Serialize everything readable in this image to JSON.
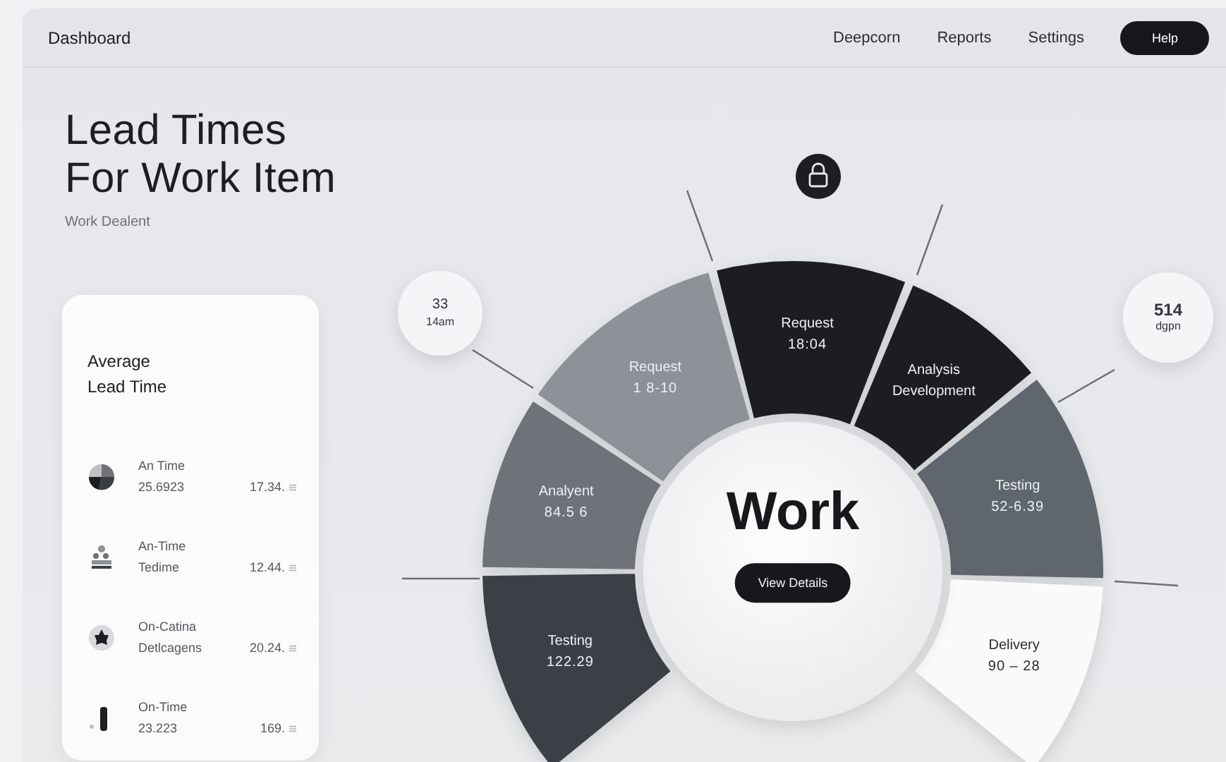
{
  "nav": {
    "title": "Dashboard",
    "links": [
      "Deepcorn",
      "Reports",
      "Settings"
    ],
    "help": "Help"
  },
  "heading": {
    "title": "Lead Times\nFor Work Item",
    "subtitle": "Work Dealent"
  },
  "card": {
    "title": "Average\nLead Time",
    "items": [
      {
        "kind": "pie",
        "name": "An Time",
        "detail": "25.6923",
        "value": "17.34."
      },
      {
        "kind": "people",
        "name": "An-Time",
        "detail": "Tedime",
        "value": "12.44."
      },
      {
        "kind": "badge",
        "name": "On-Catina",
        "detail": "Detlcagens",
        "value": "20.24."
      },
      {
        "kind": "bar",
        "name": "On-Time",
        "detail": "23.223",
        "value": "169."
      }
    ]
  },
  "wheel": {
    "center": "Work",
    "button": "View Details",
    "segments": [
      {
        "name": "Request",
        "value": "18:04",
        "color": "#1c1e22"
      },
      {
        "name": "Request",
        "value": "1 8-10",
        "color": "#8d9198"
      },
      {
        "name": "Analysis\nDevelopment",
        "color": "#1c1e22"
      },
      {
        "name": "Analyent",
        "value": "84.5 6",
        "color": "#6e7279"
      },
      {
        "name": "Testing",
        "value": "52-6.39",
        "color": "#61666d"
      },
      {
        "name": "Testing",
        "value": "122.29",
        "color": "#3a3f47"
      },
      {
        "name": "Delivery",
        "value": "90 – 28",
        "color": "#fafafa"
      }
    ],
    "bubbles": [
      {
        "value": "33",
        "unit": "14am"
      },
      {
        "value": "514",
        "unit": "dgpn"
      }
    ]
  }
}
